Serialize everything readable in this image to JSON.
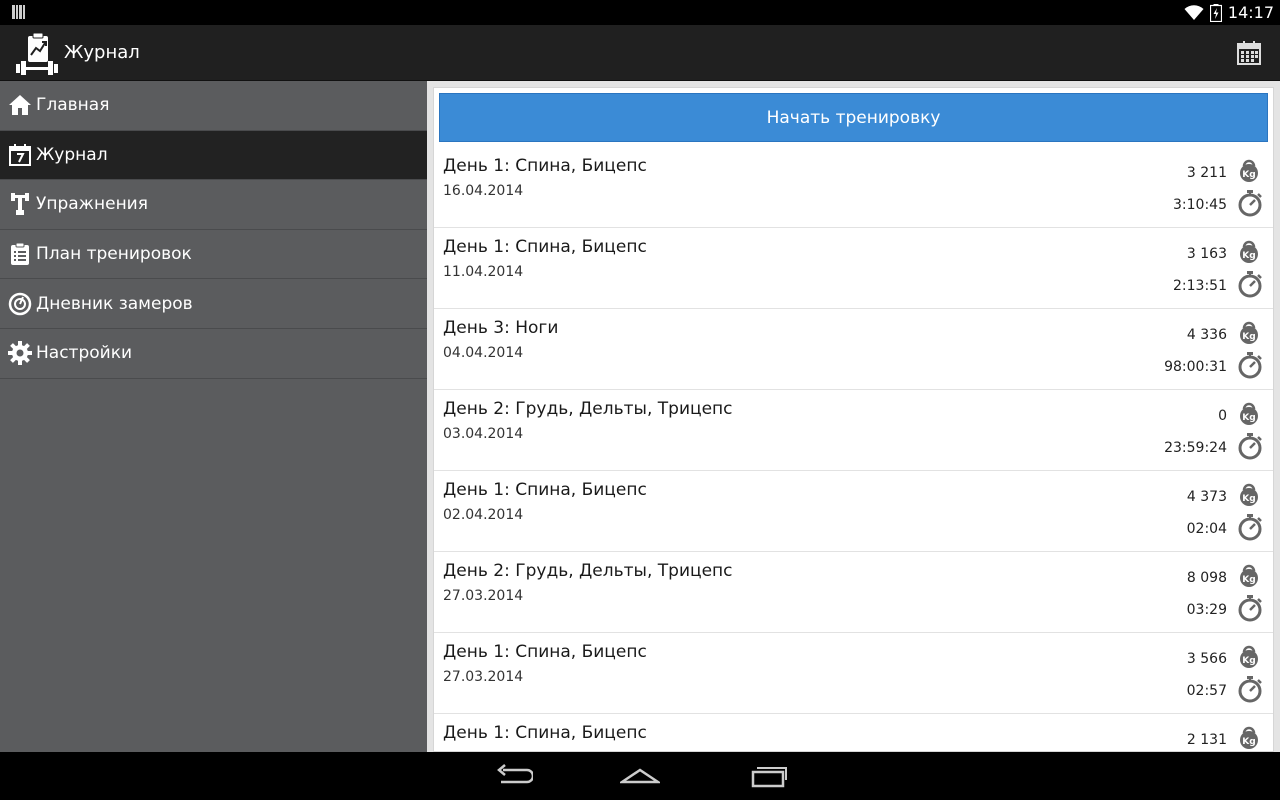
{
  "status": {
    "time": "14:17"
  },
  "app": {
    "title": "Журнал"
  },
  "drawer": {
    "items": [
      {
        "label": "Главная",
        "icon": "home-icon",
        "active": false
      },
      {
        "label": "Журнал",
        "icon": "calendar-icon",
        "active": true
      },
      {
        "label": "Упражнения",
        "icon": "dumbbell-icon",
        "active": false
      },
      {
        "label": "План тренировок",
        "icon": "clipboard-icon",
        "active": false
      },
      {
        "label": "Дневник замеров",
        "icon": "gauge-icon",
        "active": false
      },
      {
        "label": "Настройки",
        "icon": "gear-icon",
        "active": false
      }
    ]
  },
  "main": {
    "start_button": "Начать тренировку",
    "workouts": [
      {
        "title": "День 1: Спина, Бицепс",
        "date": "16.04.2014",
        "weight": "3 211",
        "duration": "3:10:45"
      },
      {
        "title": "День 1: Спина, Бицепс",
        "date": "11.04.2014",
        "weight": "3 163",
        "duration": "2:13:51"
      },
      {
        "title": "День 3: Ноги",
        "date": "04.04.2014",
        "weight": "4 336",
        "duration": "98:00:31"
      },
      {
        "title": "День 2: Грудь, Дельты, Трицепс",
        "date": "03.04.2014",
        "weight": "0",
        "duration": "23:59:24"
      },
      {
        "title": "День 1: Спина, Бицепс",
        "date": "02.04.2014",
        "weight": "4 373",
        "duration": "02:04"
      },
      {
        "title": "День 2: Грудь, Дельты, Трицепс",
        "date": "27.03.2014",
        "weight": "8 098",
        "duration": "03:29"
      },
      {
        "title": "День 1: Спина, Бицепс",
        "date": "27.03.2014",
        "weight": "3 566",
        "duration": "02:57"
      },
      {
        "title": "День 1: Спина, Бицепс",
        "date": "",
        "weight": "2 131",
        "duration": ""
      }
    ]
  },
  "colors": {
    "accent": "#3b8bd6",
    "drawer": "#5b5c5e",
    "drawer_active": "#222222",
    "action_bar": "#202020"
  }
}
